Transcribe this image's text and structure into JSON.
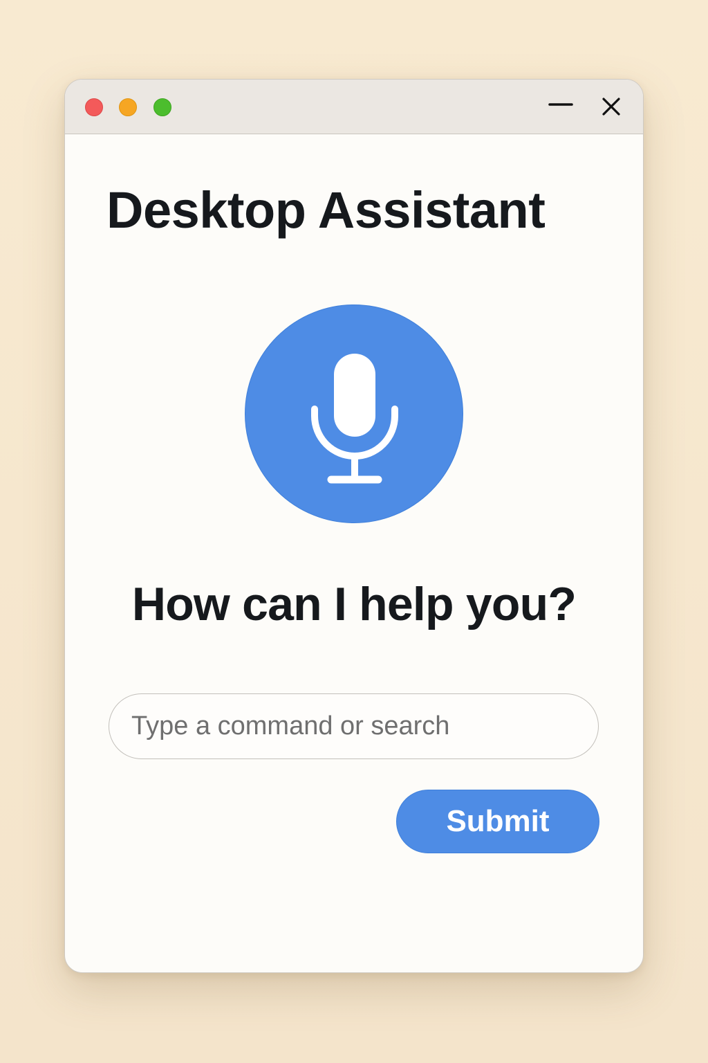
{
  "window": {
    "controls": {
      "close_dot_color": "#f35a5a",
      "minimize_dot_color": "#f6a623",
      "zoom_dot_color": "#4cbd2d",
      "minimize_icon": "minus-icon",
      "close_icon": "x-icon"
    }
  },
  "app": {
    "title": "Desktop Assistant"
  },
  "voice": {
    "icon": "microphone-icon",
    "accent_color": "#4e8ce5"
  },
  "prompt": {
    "text": "How can I help you?"
  },
  "search": {
    "placeholder": "Type a command or search",
    "value": ""
  },
  "actions": {
    "submit_label": "Submit"
  }
}
